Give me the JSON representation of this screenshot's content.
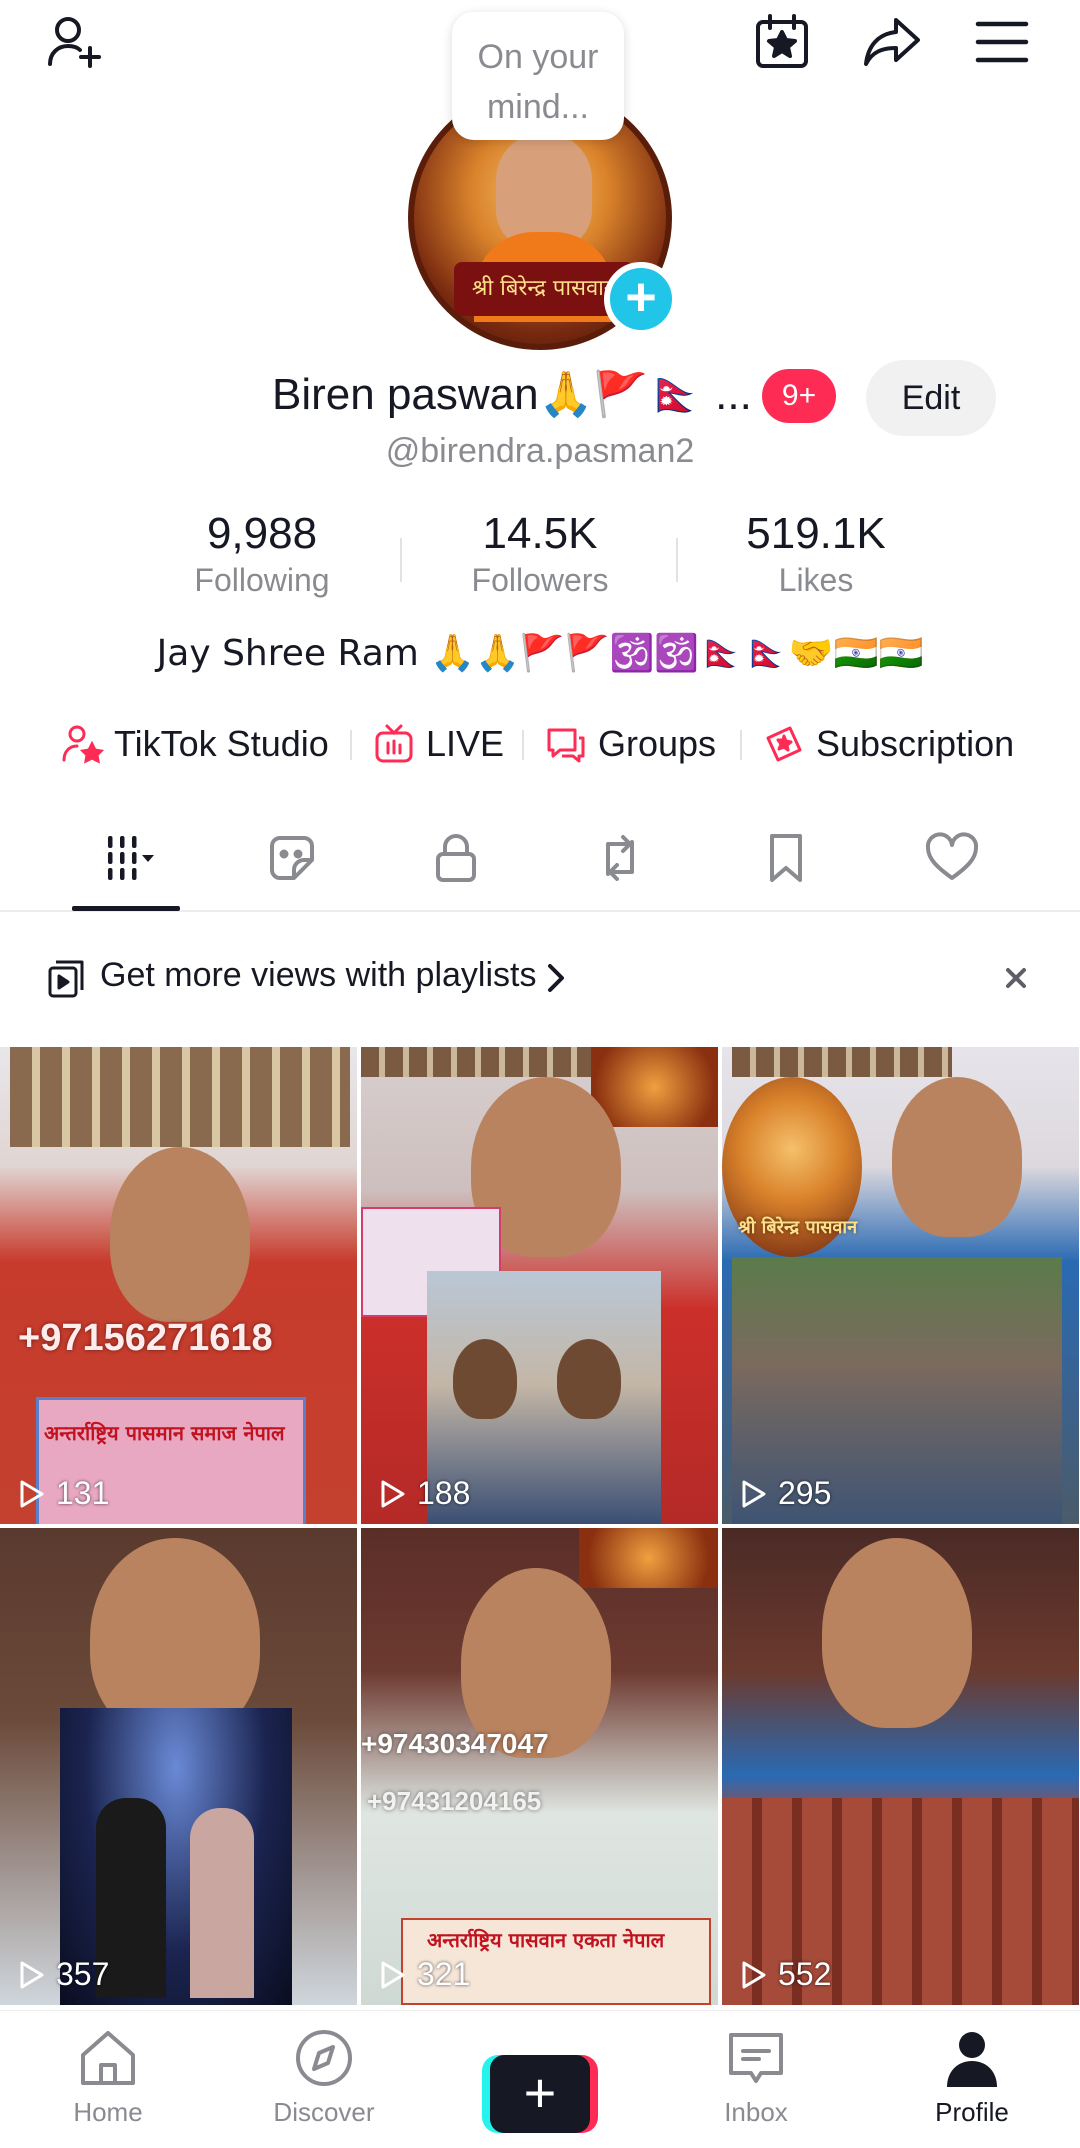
{
  "header": {
    "add_friend_icon": "person-plus-icon",
    "bubble_text": "On your mind...",
    "avatar_banner": "श्री बिरेन्द्र पासवान",
    "icons": [
      "calendar-star-icon",
      "share-arrow-icon",
      "hamburger-menu-icon"
    ]
  },
  "profile": {
    "name": "Biren paswan🙏🚩🇳🇵 ...",
    "notification_badge": "9+",
    "edit_label": "Edit",
    "handle": "@birendra.pasman2",
    "bio": "Jay Shree Ram 🙏🙏🚩🚩🕉️🕉️🇳🇵🇳🇵🤝🇮🇳🇮🇳"
  },
  "stats": [
    {
      "value": "9,988",
      "label": "Following"
    },
    {
      "value": "14.5K",
      "label": "Followers"
    },
    {
      "value": "519.1K",
      "label": "Likes"
    }
  ],
  "shortcuts": [
    {
      "label": "TikTok Studio",
      "icon": "studio-icon"
    },
    {
      "label": "LIVE",
      "icon": "live-tv-icon"
    },
    {
      "label": "Groups",
      "icon": "chat-bubbles-icon"
    },
    {
      "label": "Subscription",
      "icon": "subscription-icon"
    }
  ],
  "tabs": [
    {
      "name": "videos",
      "icon": "grid-icon",
      "active": true
    },
    {
      "name": "stickers",
      "icon": "sticker-icon"
    },
    {
      "name": "private",
      "icon": "lock-icon"
    },
    {
      "name": "reposts",
      "icon": "repost-icon"
    },
    {
      "name": "saved",
      "icon": "bookmark-icon"
    },
    {
      "name": "liked",
      "icon": "heart-icon"
    }
  ],
  "promo": {
    "text": "Get more views with playlists"
  },
  "videos": [
    {
      "views": "131",
      "overlay": "+97156271618",
      "banner": "अन्तर्राष्ट्रिय पासमान समाज नेपाल"
    },
    {
      "views": "188"
    },
    {
      "views": "295",
      "banner": "श्री बिरेन्द्र पासवान"
    },
    {
      "views": "357"
    },
    {
      "views": "321",
      "overlay": "+97430347047",
      "overlay2": "+97431204165",
      "banner": "अन्तर्राष्ट्रिय पासवान एकता नेपाल"
    },
    {
      "views": "552"
    }
  ],
  "nav": [
    {
      "label": "Home",
      "icon": "home-icon"
    },
    {
      "label": "Discover",
      "icon": "compass-icon"
    },
    {
      "label": "",
      "icon": "plus-icon"
    },
    {
      "label": "Inbox",
      "icon": "inbox-icon"
    },
    {
      "label": "Profile",
      "icon": "profile-icon",
      "active": true
    }
  ],
  "colors": {
    "accent": "#fe2c55",
    "cyan": "#25f4ee",
    "text": "#161823",
    "muted": "#8a8b91",
    "avatar_plus": "#20c5e8"
  }
}
